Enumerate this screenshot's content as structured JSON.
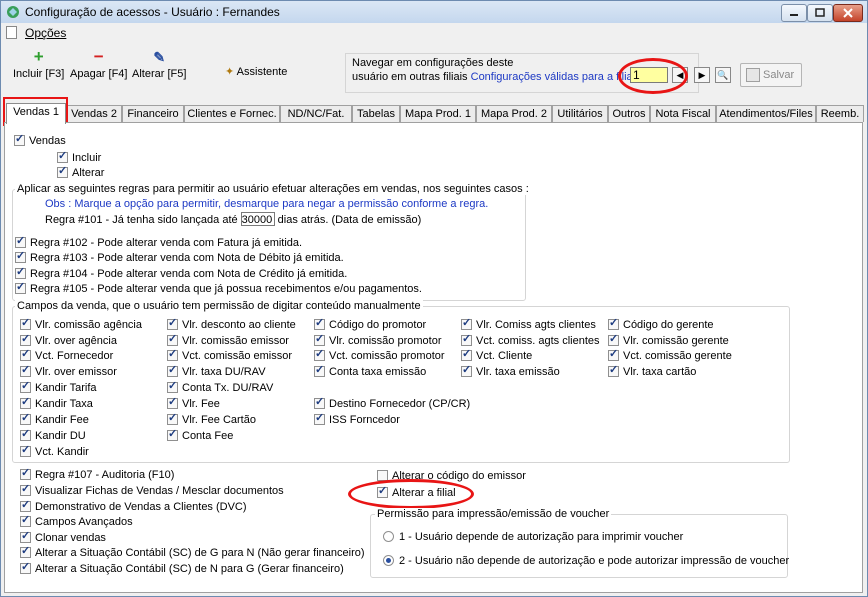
{
  "window": {
    "title": "Configuração de acessos - Usuário : Fernandes"
  },
  "menu": {
    "opcoes": "Opções"
  },
  "toolbar": {
    "incluir": "Incluir [F3]",
    "apagar": "Apagar [F4]",
    "alterar": "Alterar [F5]",
    "assistente": "Assistente",
    "salvar": "Salvar"
  },
  "nav": {
    "title": "Navegar em configurações deste",
    "line2_prefix": "usuário em outras filiais",
    "link": "Configurações válidas para a filial",
    "filial_value": "1"
  },
  "tabs": [
    "Vendas 1",
    "Vendas 2",
    "Financeiro",
    "Clientes e Fornec.",
    "ND/NC/Fat.",
    "Tabelas",
    "Mapa Prod. 1",
    "Mapa Prod. 2",
    "Utilitários",
    "Outros",
    "Nota Fiscal",
    "Atendimentos/Files",
    "Reemb."
  ],
  "vendas": {
    "main": "Vendas",
    "incluir": "Incluir",
    "alterar": "Alterar"
  },
  "rules": {
    "title": "Aplicar as seguintes regras para permitir ao usuário efetuar alterações em vendas, nos seguintes casos :",
    "obs": "Obs : Marque a opção para permitir, desmarque para negar a permissão conforme a regra.",
    "r101_prefix": "Regra #101 - Já tenha sido lançada até",
    "r101_value": "30000",
    "r101_suffix": "dias atrás. (Data de emissão)",
    "r102": "Regra #102 - Pode alterar venda com Fatura já emitida.",
    "r103": "Regra #103 - Pode alterar venda com Nota de Débito já emitida.",
    "r104": "Regra #104 - Pode alterar venda com Nota de Crédito já emitida.",
    "r105": "Regra #105 - Pode alterar venda que já possua recebimentos e/ou pagamentos."
  },
  "campos": {
    "title": "Campos da venda, que o usuário tem permissão de digitar conteúdo manualmente",
    "col1": [
      "Vlr. comissão agência",
      "Vlr. over agência",
      "Vct. Fornecedor",
      "Vlr. over emissor",
      "Kandir Tarifa",
      "Kandir Taxa",
      "Kandir Fee",
      "Kandir DU",
      "Vct. Kandir"
    ],
    "col2": [
      "Vlr. desconto ao cliente",
      "Vlr. comissão emissor",
      "Vct. comissão emissor",
      "Vlr. taxa DU/RAV",
      "Conta Tx. DU/RAV",
      "Vlr. Fee",
      "Vlr. Fee Cartão",
      "Conta Fee"
    ],
    "col3": [
      "Código do promotor",
      "Vlr. comissão promotor",
      "Vct. comissão promotor",
      "Conta taxa emissão",
      "",
      "Destino Fornecedor (CP/CR)",
      "ISS Forncedor"
    ],
    "col4": [
      "Vlr. Comiss agts clientes",
      "Vct. comiss. agts clientes",
      "Vct. Cliente",
      "Vlr. taxa emissão"
    ],
    "col5": [
      "Código do gerente",
      "Vlr. comissão gerente",
      "Vct. comissão gerente",
      "Vlr. taxa cartão"
    ]
  },
  "bottom": {
    "left": [
      "Regra #107 - Auditoria (F10)",
      "Visualizar Fichas de Vendas / Mesclar documentos",
      "Demonstrativo de Vendas a Clientes (DVC)",
      "Campos Avançados",
      "Clonar vendas",
      "Alterar a Situação Contábil (SC) de G para N (Não gerar financeiro)",
      "Alterar a Situação Contábil (SC) de N para G (Gerar financeiro)"
    ],
    "alterar_emissor": "Alterar o código do emissor",
    "alterar_filial": "Alterar a filial"
  },
  "voucher": {
    "title": "Permissão para impressão/emissão de voucher",
    "opt1": "1 - Usuário depende de autorização para imprimir voucher",
    "opt2": "2 - Usuário não depende de autorização e pode autorizar impressão de voucher"
  },
  "colors": {
    "accent": "#1d39c4",
    "highlight": "#e81515",
    "input_bg": "#ffffa0"
  }
}
